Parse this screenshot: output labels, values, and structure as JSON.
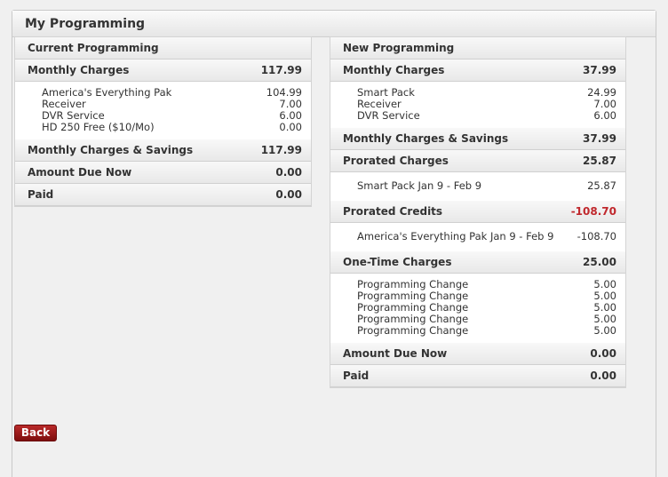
{
  "page": {
    "title": "My Programming"
  },
  "current": {
    "title": "Current Programming",
    "monthly": {
      "label": "Monthly Charges",
      "amount": "117.99"
    },
    "items": [
      {
        "name": "America's Everything Pak",
        "amount": "104.99"
      },
      {
        "name": "Receiver",
        "amount": "7.00"
      },
      {
        "name": "DVR Service",
        "amount": "6.00"
      },
      {
        "name": "HD 250 Free ($10/Mo)",
        "amount": "0.00"
      }
    ],
    "savings": {
      "label": "Monthly Charges & Savings",
      "amount": "117.99"
    },
    "due": {
      "label": "Amount Due Now",
      "amount": "0.00"
    },
    "paid": {
      "label": "Paid",
      "amount": "0.00"
    }
  },
  "new": {
    "title": "New Programming",
    "monthly": {
      "label": "Monthly Charges",
      "amount": "37.99"
    },
    "items": [
      {
        "name": "Smart Pack",
        "amount": "24.99"
      },
      {
        "name": "Receiver",
        "amount": "7.00"
      },
      {
        "name": "DVR Service",
        "amount": "6.00"
      }
    ],
    "savings": {
      "label": "Monthly Charges & Savings",
      "amount": "37.99"
    },
    "prorated_charges": {
      "label": "Prorated Charges",
      "amount": "25.87"
    },
    "prorated_charge_items": [
      {
        "name": "Smart Pack Jan 9 - Feb 9",
        "amount": "25.87"
      }
    ],
    "prorated_credits": {
      "label": "Prorated Credits",
      "amount": "-108.70"
    },
    "prorated_credit_items": [
      {
        "name": "America's Everything Pak Jan 9 - Feb 9",
        "amount": "-108.70"
      }
    ],
    "one_time": {
      "label": "One-Time Charges",
      "amount": "25.00"
    },
    "one_time_items": [
      {
        "name": "Programming Change",
        "amount": "5.00"
      },
      {
        "name": "Programming Change",
        "amount": "5.00"
      },
      {
        "name": "Programming Change",
        "amount": "5.00"
      },
      {
        "name": "Programming Change",
        "amount": "5.00"
      },
      {
        "name": "Programming Change",
        "amount": "5.00"
      }
    ],
    "due": {
      "label": "Amount Due Now",
      "amount": "0.00"
    },
    "paid": {
      "label": "Paid",
      "amount": "0.00"
    }
  },
  "actions": {
    "back_label": "Back"
  },
  "colors": {
    "negative": "#c0282d",
    "button": "#9b1c1c"
  }
}
